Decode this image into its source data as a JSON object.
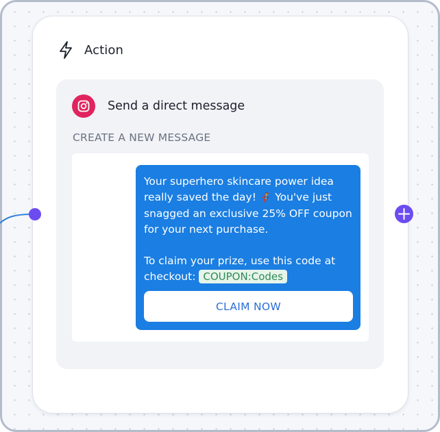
{
  "card": {
    "title": "Action",
    "title_icon": "lightning-bolt-icon"
  },
  "step": {
    "platform_icon": "instagram-icon",
    "label": "Send a direct message"
  },
  "section": {
    "label": "CREATE A NEW MESSAGE"
  },
  "message": {
    "line1": "Your superhero skincare power idea",
    "line2_pre": "really saved the day! ",
    "emoji": "🦸",
    "line2_post": " You've just",
    "line3": "snagged an exclusive 25% OFF coupon",
    "line4": "for your next purchase.",
    "line5": "To claim your prize, use this code at",
    "line6_pre": "checkout: ",
    "coupon_code": "COUPON:Codes",
    "button_label": "CLAIM NOW"
  },
  "colors": {
    "accent": "#6c4cf0",
    "bubble": "#1a7ee2",
    "instagram": "#e0245e",
    "coupon_text": "#2e8b57"
  },
  "icons": {
    "left_handle": "connection-dot",
    "right_handle": "plus-icon"
  }
}
